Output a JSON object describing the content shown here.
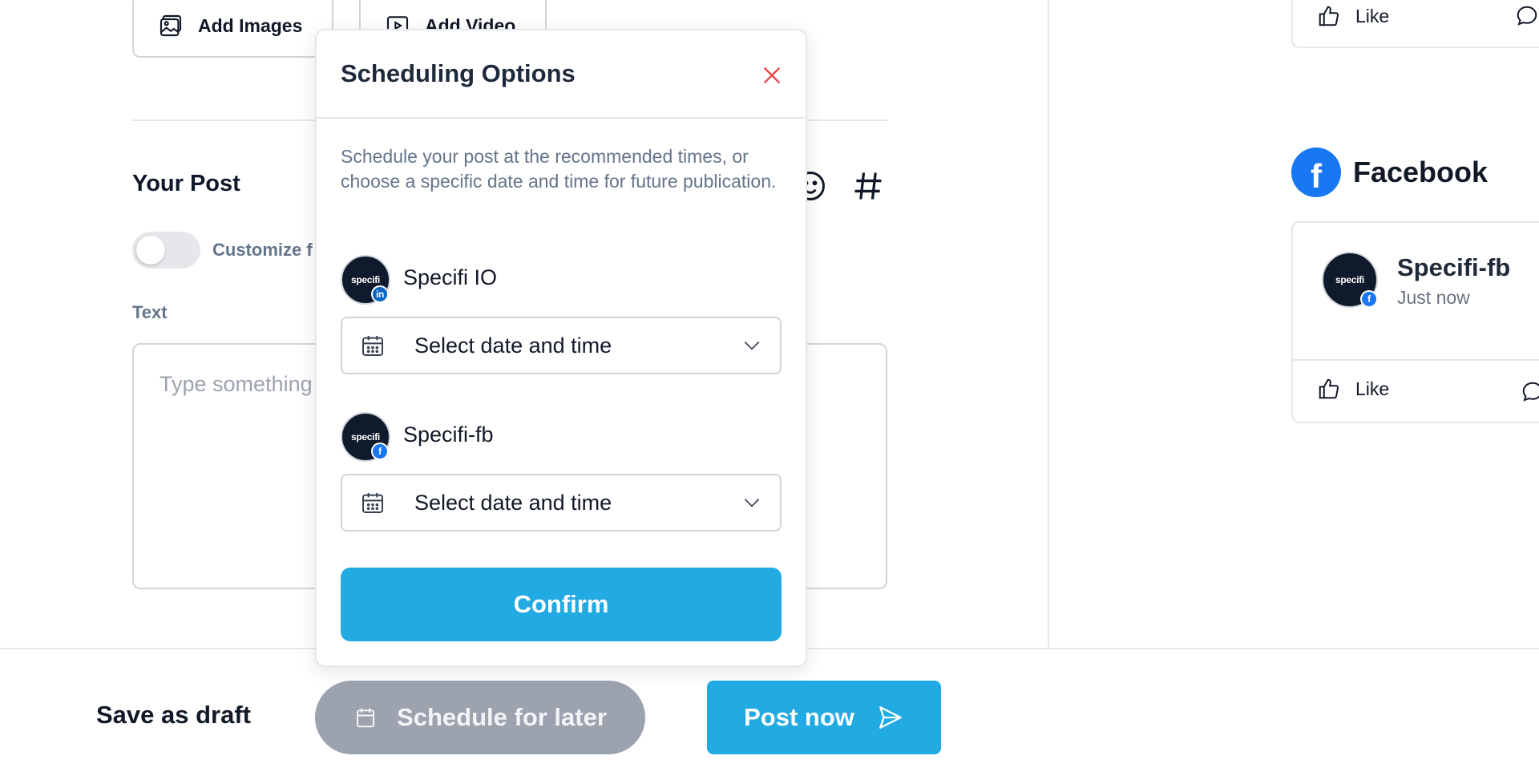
{
  "media": {
    "add_images": "Add Images",
    "add_video": "Add Video"
  },
  "post": {
    "section_title": "Your Post",
    "customize_label": "Customize f",
    "text_label": "Text",
    "text_placeholder": "Type something"
  },
  "preview": {
    "top_like": "Like",
    "facebook_title": "Facebook",
    "facebook_logo_letter": "f",
    "fb_account_name": "Specifi-fb",
    "fb_post_time": "Just now",
    "fb_like": "Like",
    "avatar_text": "specifi"
  },
  "footer": {
    "save_draft": "Save as draft",
    "schedule_later": "Schedule for later",
    "post_now": "Post now"
  },
  "modal": {
    "title": "Scheduling Options",
    "description": "Schedule your post at the recommended times, or choose a specific date and time for future publication.",
    "accounts": [
      {
        "name": "Specifi IO",
        "network": "linkedin",
        "badge": "in",
        "picker_value": "Select date and time"
      },
      {
        "name": "Specifi-fb",
        "network": "facebook",
        "badge": "f",
        "picker_value": "Select date and time"
      }
    ],
    "confirm_label": "Confirm"
  },
  "colors": {
    "primary": "#22aae2",
    "disabled_button": "#9ca3af",
    "close_icon": "#ef4444",
    "facebook": "#1877f2",
    "linkedin": "#0a66c2"
  }
}
